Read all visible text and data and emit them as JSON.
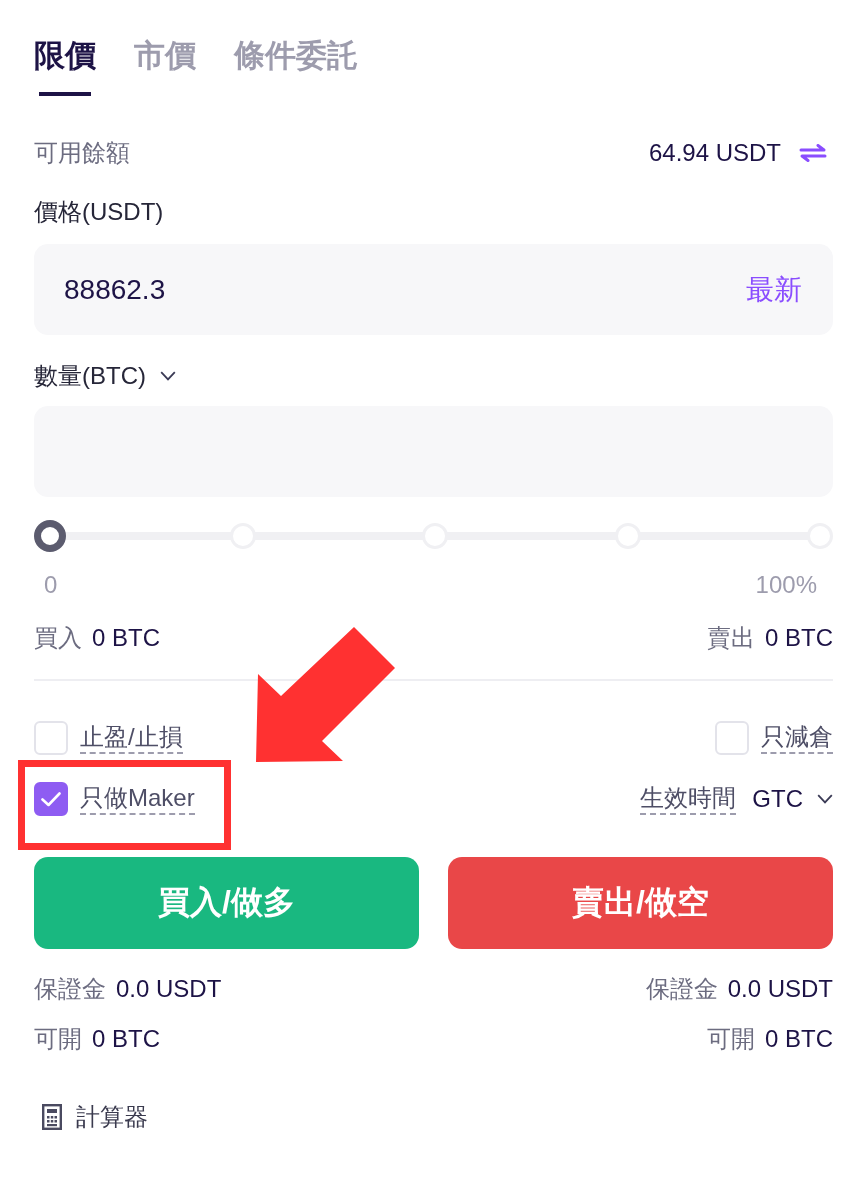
{
  "order_tabs": [
    {
      "label": "限價",
      "selected": true
    },
    {
      "label": "市價",
      "selected": false
    },
    {
      "label": "條件委託",
      "selected": false
    }
  ],
  "balance": {
    "label": "可用餘額",
    "value": "64.94 USDT"
  },
  "price": {
    "label": "價格(USDT)",
    "value": "88862.3",
    "action": "最新"
  },
  "quantity": {
    "label": "數量(BTC)"
  },
  "slider": {
    "level": 0,
    "min_label": "0",
    "max_label": "100%"
  },
  "max_amounts": [
    {
      "label": "買入",
      "value": "0 BTC"
    },
    {
      "label": "賣出",
      "value": "0 BTC"
    }
  ],
  "options": [
    {
      "label": "止盈/止損",
      "checked": false,
      "highlighted": false
    },
    {
      "label": "只減倉",
      "checked": false,
      "highlighted": false
    },
    {
      "label": "只做Maker",
      "checked": true,
      "highlighted": true
    }
  ],
  "time_in_force": {
    "label": "生效時間",
    "value": "GTC"
  },
  "actions": [
    {
      "label": "買入/做多",
      "kind": "buy"
    },
    {
      "label": "賣出/做空",
      "kind": "sell"
    }
  ],
  "summary": [
    {
      "margin_label": "保證金",
      "margin": "0.0 USDT",
      "open_label": "可開",
      "open": "0 BTC"
    },
    {
      "margin_label": "保證金",
      "margin": "0.0 USDT",
      "open_label": "可開",
      "open": "0 BTC"
    }
  ],
  "calculator": {
    "label": "計算器"
  }
}
